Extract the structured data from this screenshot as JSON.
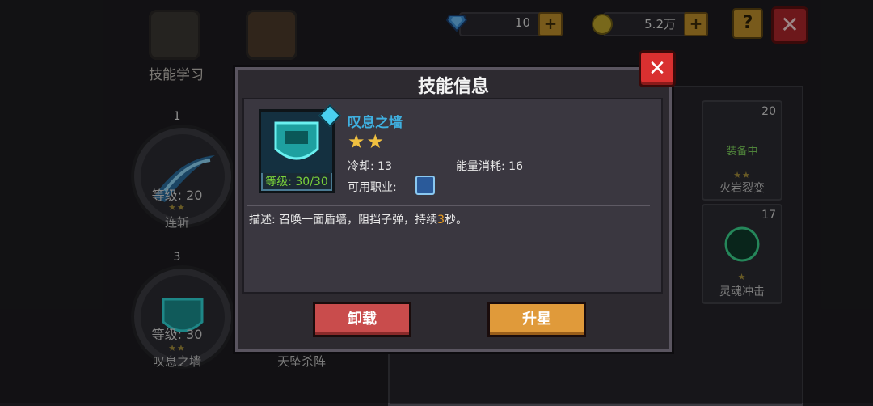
{
  "top": {
    "skill_learn_label": "技能学习",
    "gems": "10",
    "gold": "5.2万",
    "plus": "+",
    "help": "?",
    "close": "✕"
  },
  "left_skills": [
    {
      "slot": "1",
      "level_text": "等级: 20",
      "stars": "★★",
      "name": "连斩"
    },
    {
      "slot": "3",
      "level_text": "等级: 30",
      "stars": "★★",
      "name": "叹息之墙"
    }
  ],
  "center_skill": {
    "name": "天坠杀阵"
  },
  "right_cards": [
    {
      "level": "20",
      "status": "装备中",
      "stars": "★★",
      "name": "火岩裂变"
    },
    {
      "level": "17",
      "stars": "★",
      "name": "灵魂冲击"
    }
  ],
  "modal": {
    "title": "技能信息",
    "close": "✕",
    "skill_name": "叹息之墙",
    "stars": "★★",
    "level_text": "等级: 30/30",
    "cooldown": "冷却: 13",
    "energy": "能量消耗: 16",
    "class_label": "可用职业:",
    "description_prefix": "描述: 召唤一面盾墙，阻挡子弹，持续",
    "description_highlight": "3",
    "description_suffix": "秒。",
    "unload_label": "卸载",
    "upstar_label": "升星"
  },
  "colors": {
    "accent_blue": "#3fb0e0",
    "level_green": "#7ad23a",
    "highlight_orange": "#f0a020",
    "unload_red": "#c94c4c",
    "upstar_orange": "#e09a3a"
  }
}
